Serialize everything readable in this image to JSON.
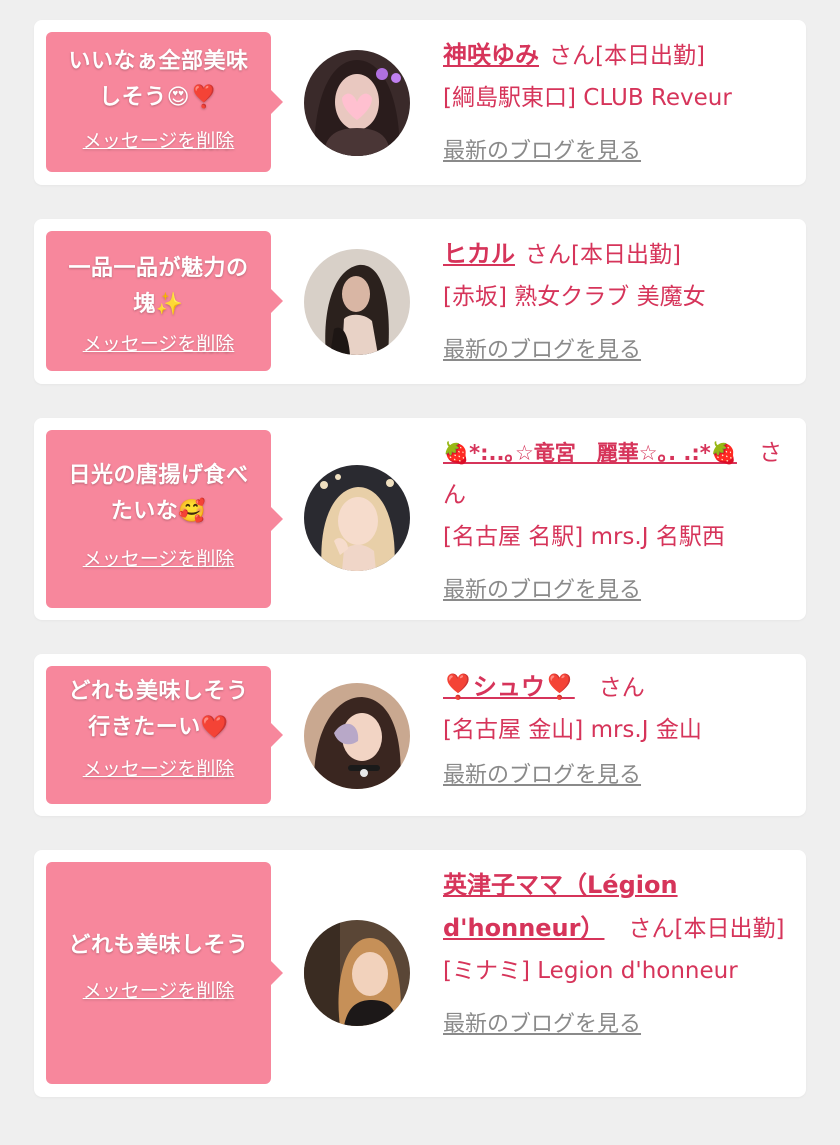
{
  "cards": [
    {
      "message": "いいなぁ全部美味しそう😍❣️",
      "delete_label": "メッセージを削除",
      "name": "神咲ゆみ",
      "suffix": "さん[本日出勤]",
      "store": "[綱島駅東口] CLUB Reveur",
      "blog_label": "最新のブログを見る"
    },
    {
      "message": "一品一品が魅力の塊✨",
      "delete_label": "メッセージを削除",
      "name": "ヒカル",
      "suffix": "さん[本日出勤]",
      "store": "[赤坂] 熟女クラブ 美魔女",
      "blog_label": "最新のブログを見る"
    },
    {
      "message": "日光の唐揚げ食べたいな🥰",
      "delete_label": "メッセージを削除",
      "name": "🍓*:..｡☆竜宮　麗華☆｡. .:*🍓",
      "suffix": "さん",
      "store": "[名古屋 名駅] mrs.J 名駅西",
      "blog_label": "最新のブログを見る"
    },
    {
      "message": "どれも美味しそう行きたーい❤️",
      "delete_label": "メッセージを削除",
      "name": "❣️シュウ❣️",
      "suffix": "さん",
      "store": "[名古屋 金山] mrs.J 金山",
      "blog_label": "最新のブログを見る"
    },
    {
      "message": "どれも美味しそう",
      "delete_label": "メッセージを削除",
      "name": "英津子ママ（Légion d'honneur）",
      "suffix": "さん[本日出勤]",
      "store": "[ミナミ] Legion d'honneur",
      "blog_label": "最新のブログを見る"
    }
  ],
  "colors": {
    "bubble": "#f7879c",
    "name": "#d6345a",
    "blog_link": "#8a8a8a",
    "background": "#efefef"
  }
}
